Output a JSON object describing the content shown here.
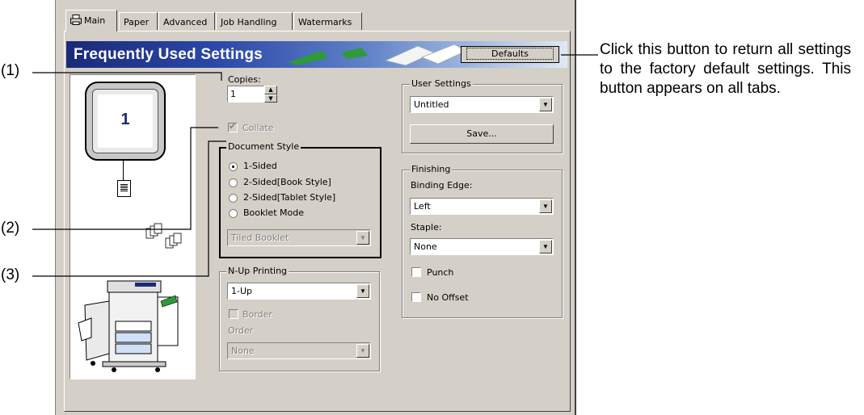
{
  "tabs": [
    {
      "label": "Main",
      "icon": "printer-icon",
      "active": true
    },
    {
      "label": "Paper",
      "active": false
    },
    {
      "label": "Advanced",
      "active": false
    },
    {
      "label": "Job Handling",
      "active": false
    },
    {
      "label": "Watermarks",
      "active": false
    }
  ],
  "banner": {
    "title": "Frequently Used Settings"
  },
  "defaults_button": {
    "label": "Defaults"
  },
  "preview": {
    "page_number": "1"
  },
  "copies": {
    "label": "Copies:",
    "value": "1"
  },
  "collate": {
    "label": "Collate",
    "checked": true,
    "enabled": false
  },
  "document_style": {
    "label": "Document Style",
    "options": [
      "1-Sided",
      "2-Sided[Book Style]",
      "2-Sided[Tablet Style]",
      "Booklet Mode"
    ],
    "selected": "1-Sided",
    "booklet_select": "Tiled Booklet"
  },
  "nup": {
    "label": "N-Up Printing",
    "value": "1-Up",
    "border_label": "Border",
    "order_label": "Order",
    "order_value": "None"
  },
  "user_settings": {
    "label": "User Settings",
    "value": "Untitled",
    "save_label": "Save..."
  },
  "finishing": {
    "label": "Finishing",
    "binding_label": "Binding Edge:",
    "binding_value": "Left",
    "staple_label": "Staple:",
    "staple_value": "None",
    "punch_label": "Punch",
    "no_offset_label": "No Offset"
  },
  "callouts": {
    "c1": "(1)",
    "c2": "(2)",
    "c3": "(3)",
    "description": "Click this button to return all settings to the factory default settings. This button appears on all tabs."
  }
}
